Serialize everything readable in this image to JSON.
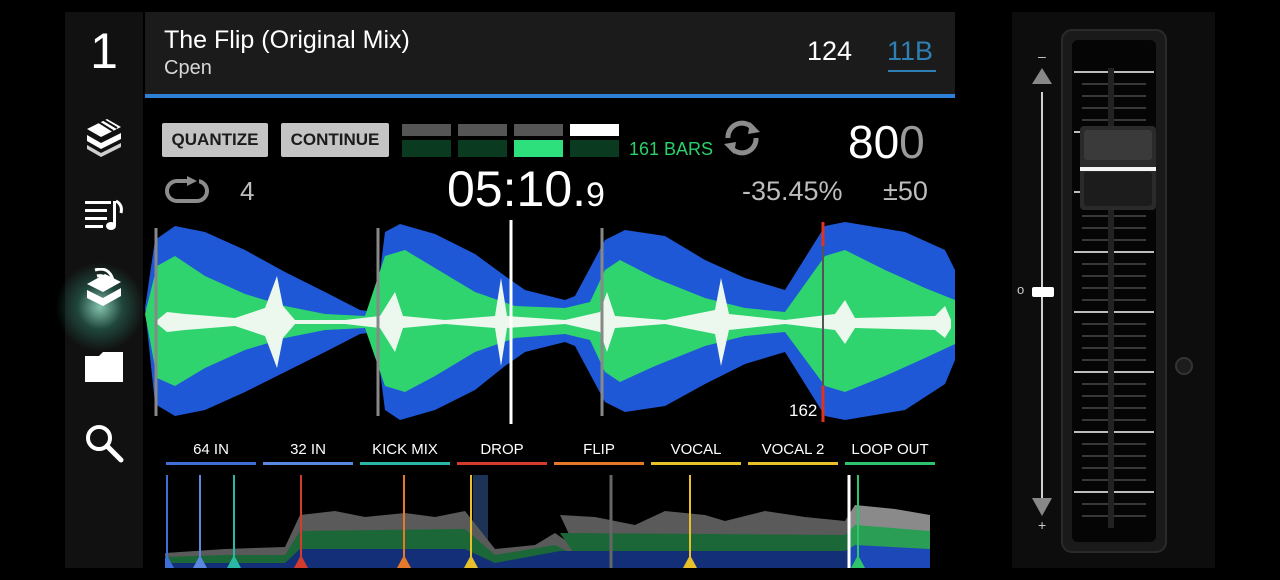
{
  "deck": {
    "number": "1"
  },
  "sidebar": {
    "items": [
      {
        "icon": "collection-icon"
      },
      {
        "icon": "playlist-icon"
      },
      {
        "icon": "link-browse-icon",
        "active": true
      },
      {
        "icon": "folder-icon"
      },
      {
        "icon": "search-icon"
      }
    ]
  },
  "track": {
    "title": "The Flip (Original Mix)",
    "artist": "Cpen",
    "bpm": "124",
    "key": "11B"
  },
  "controls": {
    "quantize_label": "QUANTIZE",
    "continue_label": "CONTINUE"
  },
  "beat_countdown": {
    "bars_label": "161 BARS",
    "active_beat": 3
  },
  "tempo": {
    "main": "80",
    "decimal": "0"
  },
  "loop": {
    "count": "4"
  },
  "time": {
    "main": "05:10.",
    "decimal": "9"
  },
  "pitch": {
    "value": "-35.45%",
    "range": "±50"
  },
  "waveform": {
    "bar_number": "162"
  },
  "hot_cues": [
    {
      "label": "64 IN",
      "color": "#3f6fd6"
    },
    {
      "label": "32 IN",
      "color": "#5a87e0"
    },
    {
      "label": "KICK MIX",
      "color": "#2ab7a6"
    },
    {
      "label": "DROP",
      "color": "#d43a2d"
    },
    {
      "label": "FLIP",
      "color": "#e6782a"
    },
    {
      "label": "VOCAL",
      "color": "#e8c12a"
    },
    {
      "label": "VOCAL 2",
      "color": "#e8c12a"
    },
    {
      "label": "LOOP OUT",
      "color": "#2ec46a"
    }
  ],
  "tempo_fader": {
    "top_label": "–",
    "bottom_label": "+",
    "center_label": "o"
  },
  "colors": {
    "accent": "#2e7fd6",
    "waveform_blue": "#1e58d6",
    "waveform_green": "#2fd46e",
    "bars_green": "#29d16a"
  }
}
